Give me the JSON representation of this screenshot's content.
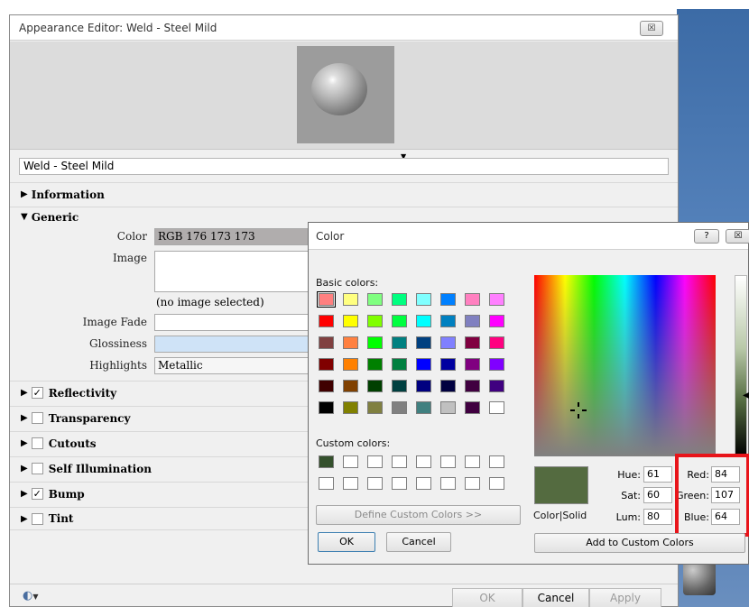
{
  "editor": {
    "title": "Appearance Editor: Weld - Steel Mild",
    "close_glyph": "☒",
    "material_name": "Weld - Steel Mild",
    "sections": [
      {
        "label": "Information",
        "expanded": false,
        "checkbox": null
      },
      {
        "label": "Generic",
        "expanded": true,
        "checkbox": null
      },
      {
        "label": "Reflectivity",
        "expanded": false,
        "checkbox": true
      },
      {
        "label": "Transparency",
        "expanded": false,
        "checkbox": false
      },
      {
        "label": "Cutouts",
        "expanded": false,
        "checkbox": false
      },
      {
        "label": "Self Illumination",
        "expanded": false,
        "checkbox": false
      },
      {
        "label": "Bump",
        "expanded": false,
        "checkbox": true
      },
      {
        "label": "Tint",
        "expanded": false,
        "checkbox": false
      }
    ],
    "generic": {
      "color_label": "Color",
      "color_value": "RGB 176 173 173",
      "image_label": "Image",
      "image_value": "(no image selected)",
      "image_fade_label": "Image Fade",
      "glossiness_label": "Glossiness",
      "highlights_label": "Highlights",
      "highlights_value": "Metallic"
    },
    "footer": {
      "ok": "OK",
      "cancel": "Cancel",
      "apply": "Apply"
    }
  },
  "color_dialog": {
    "title": "Color",
    "help_glyph": "?",
    "close_glyph": "☒",
    "basic_colors_label": "Basic colors:",
    "custom_colors_label": "Custom colors:",
    "basic_colors": [
      "#ff8080",
      "#ffff80",
      "#80ff80",
      "#00ff80",
      "#80ffff",
      "#0080ff",
      "#ff80c0",
      "#ff80ff",
      "#ff0000",
      "#ffff00",
      "#80ff00",
      "#00ff40",
      "#00ffff",
      "#0080c0",
      "#8080c0",
      "#ff00ff",
      "#804040",
      "#ff8040",
      "#00ff00",
      "#008080",
      "#004080",
      "#8080ff",
      "#800040",
      "#ff0080",
      "#800000",
      "#ff8000",
      "#008000",
      "#008040",
      "#0000ff",
      "#0000a0",
      "#800080",
      "#8000ff",
      "#400000",
      "#804000",
      "#004000",
      "#004040",
      "#000080",
      "#000040",
      "#400040",
      "#400080",
      "#000000",
      "#808000",
      "#808040",
      "#808080",
      "#408080",
      "#c0c0c0",
      "#400040",
      "#ffffff"
    ],
    "custom_colors": [
      "#34502c",
      "#ffffff",
      "#ffffff",
      "#ffffff",
      "#ffffff",
      "#ffffff",
      "#ffffff",
      "#ffffff",
      "#ffffff",
      "#ffffff",
      "#ffffff",
      "#ffffff",
      "#ffffff",
      "#ffffff",
      "#ffffff",
      "#ffffff"
    ],
    "selected_color": "#546b40",
    "color_solid_label": "Color|Solid",
    "hue_label": "Hue:",
    "hue": "61",
    "sat_label": "Sat:",
    "sat": "60",
    "lum_label": "Lum:",
    "lum": "80",
    "red_label": "Red:",
    "red": "84",
    "green_label": "Green:",
    "green": "107",
    "blue_label": "Blue:",
    "blue": "64",
    "define_custom": "Define Custom Colors >>",
    "ok": "OK",
    "cancel": "Cancel",
    "add_custom": "Add to Custom Colors"
  }
}
